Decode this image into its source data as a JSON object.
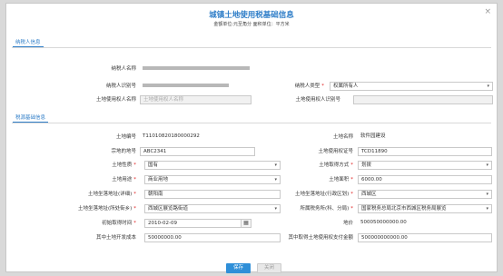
{
  "dialog": {
    "title": "城镇土地使用税基础信息",
    "subtitle": "金额单位:元至角分 面积单位：平方米",
    "close_symbol": "×"
  },
  "sections": {
    "taxpayer": "纳税人信息",
    "tax_source": "税源基础信息"
  },
  "taxpayer": {
    "name_label": "纳税人名称",
    "id_label": "纳税人识别号",
    "type_label": "纳税人类型",
    "type_value": "权属所有人",
    "land_user_name_label": "土地使用权人名称",
    "land_user_name_placeholder": "土地使用权人名称",
    "land_user_id_label": "土地使用权人识别号"
  },
  "source": {
    "land_no_label": "土地编号",
    "land_no_value": "T11010820180000292",
    "land_name_label": "土地名称",
    "land_name_value": "软件园建设",
    "parcel_label": "宗地的地号",
    "parcel_value": "ABC2341",
    "cert_label": "土地使用权证号",
    "cert_value": "TCD11890",
    "nature_label": "土地性质",
    "nature_value": "国有",
    "acq_label": "土地取得方式",
    "acq_value": "划拨",
    "use_label": "土地用途",
    "use_value": "商业用地",
    "area_label": "土地面积",
    "area_value": "6000.00",
    "addr_detail_label": "土地坐落地址(详细)",
    "addr_detail_value": "朝阳南",
    "addr_district_label": "土地坐落地址(行政区划)",
    "addr_district_value": "西城区",
    "addr_street_label": "土地坐落地址(所处街乡)",
    "addr_street_value": "西城区展览路街道",
    "tax_office_label": "所属税务所(科、分局)",
    "tax_office_value": "国家税务总局北京市西城区税务局展览",
    "acq_time_label": "初始取得时间",
    "acq_time_value": "2010-02-09",
    "price_label": "地价",
    "price_value": "500050000000.00",
    "dev_cost_label": "其中土地开发成本",
    "dev_cost_value": "50000000.00",
    "other_fee_label": "其中取得土地使用权支付金额",
    "other_fee_value": "500000000000.00",
    "required_mark": "*",
    "caret": "▾",
    "calendar_icon": "calendar-icon"
  },
  "buttons": {
    "save": "保存",
    "close": "关闭"
  }
}
